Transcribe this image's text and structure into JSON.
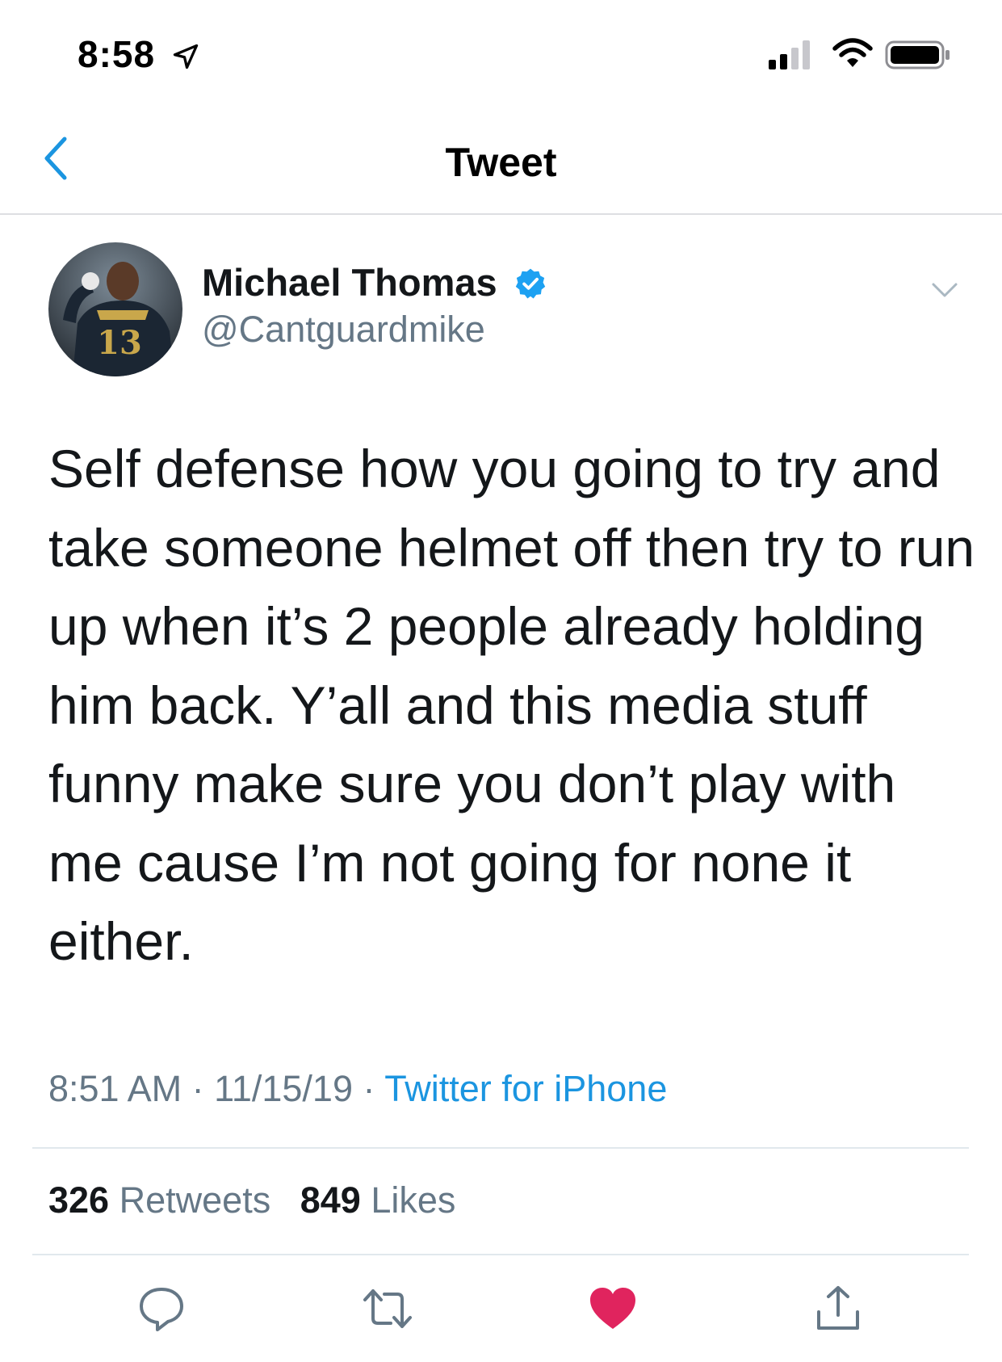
{
  "status_bar": {
    "time": "8:58",
    "icons": [
      "location-arrow-icon",
      "signal-icon",
      "wifi-icon",
      "battery-icon"
    ]
  },
  "nav": {
    "title": "Tweet",
    "back_icon": "chevron-left-icon"
  },
  "tweet": {
    "author_name": "Michael Thomas",
    "author_handle": "@Cantguardmike",
    "verified": true,
    "text": "Self defense how you going to try and take someone helmet off then try to run up when it’s 2 people already holding him back. Y’all and this media stuff funny make sure you don’t play with me cause I’m not going for none it either.",
    "time": "8:51 AM",
    "date": "11/15/19",
    "separator": "·",
    "source": "Twitter for iPhone"
  },
  "stats": {
    "retweets_count": "326",
    "retweets_label": "Retweets",
    "likes_count": "849",
    "likes_label": "Likes"
  },
  "actions": [
    "reply-icon",
    "retweet-icon",
    "like-icon",
    "share-icon"
  ],
  "colors": {
    "accent": "#1b95e0",
    "verified": "#1da1f2",
    "like": "#e0245e",
    "secondary_text": "#657786",
    "icon_gray": "#657786"
  }
}
